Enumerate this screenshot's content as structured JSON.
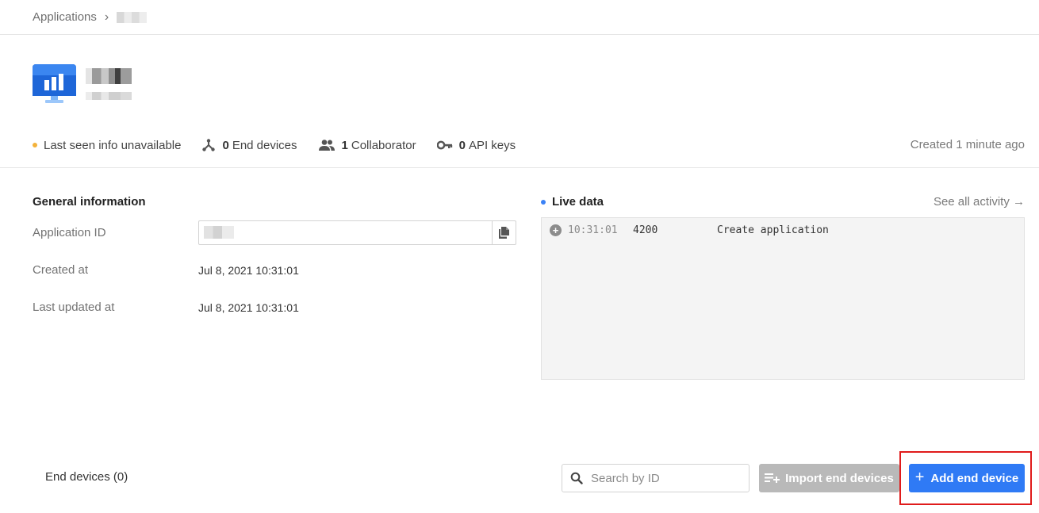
{
  "breadcrumb": {
    "root": "Applications"
  },
  "stats": {
    "last_seen": "Last seen info unavailable",
    "end_devices_count": "0",
    "end_devices_label": "End devices",
    "collaborators_count": "1",
    "collaborators_label": "Collaborator",
    "api_keys_count": "0",
    "api_keys_label": "API keys",
    "created": "Created 1 minute ago"
  },
  "general": {
    "title": "General information",
    "application_id_label": "Application ID",
    "created_at_label": "Created at",
    "created_at_value": "Jul 8, 2021 10:31:01",
    "updated_at_label": "Last updated at",
    "updated_at_value": "Jul 8, 2021 10:31:01"
  },
  "live_data": {
    "title": "Live data",
    "see_all": "See all activity →",
    "events": [
      {
        "time": "10:31:01",
        "code": "4200",
        "message": "Create application"
      }
    ]
  },
  "end_devices": {
    "title": "End devices (0)",
    "search_placeholder": "Search by ID",
    "import_label": "Import end devices",
    "add_label": "Add end device"
  },
  "colors": {
    "primary": "#2f7af5",
    "disabled": "#b9b9b9",
    "status_dot": "#f3b23b",
    "live_dot": "#3b82f6",
    "highlight": "#e01b1b"
  }
}
